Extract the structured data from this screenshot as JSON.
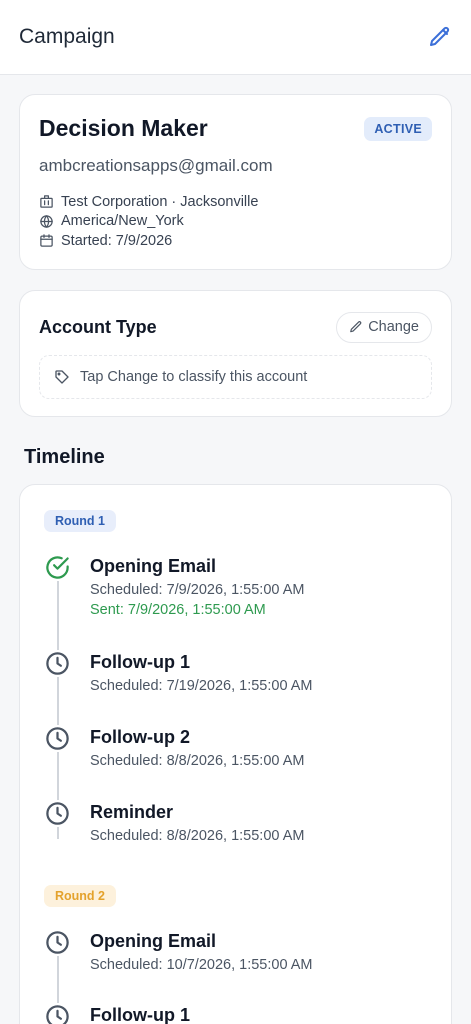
{
  "header": {
    "title": "Campaign",
    "edit_icon": "pencil-icon"
  },
  "profile": {
    "name": "Decision Maker",
    "status": "ACTIVE",
    "email": "ambcreationsapps@gmail.com",
    "company": "Test Corporation · Jacksonville",
    "timezone": "America/New_York",
    "started": "Started: 7/9/2026"
  },
  "account_type": {
    "title": "Account Type",
    "change_label": "Change",
    "placeholder": "Tap Change to classify this account"
  },
  "timeline": {
    "title": "Timeline",
    "rounds": [
      {
        "label": "Round 1",
        "items": [
          {
            "title": "Opening Email",
            "scheduled": "Scheduled: 7/9/2026, 1:55:00 AM",
            "sent": "Sent: 7/9/2026, 1:55:00 AM",
            "status": "sent"
          },
          {
            "title": "Follow-up 1",
            "scheduled": "Scheduled: 7/19/2026, 1:55:00 AM",
            "status": "pending"
          },
          {
            "title": "Follow-up 2",
            "scheduled": "Scheduled: 8/8/2026, 1:55:00 AM",
            "status": "pending"
          },
          {
            "title": "Reminder",
            "scheduled": "Scheduled: 8/8/2026, 1:55:00 AM",
            "status": "pending"
          }
        ]
      },
      {
        "label": "Round 2",
        "items": [
          {
            "title": "Opening Email",
            "scheduled": "Scheduled: 10/7/2026, 1:55:00 AM",
            "status": "pending"
          },
          {
            "title": "Follow-up 1",
            "scheduled": "",
            "status": "pending"
          }
        ]
      }
    ]
  },
  "colors": {
    "active_bg": "#e3ecfb",
    "active_fg": "#2f5fb3",
    "sent": "#2e9a4f",
    "round2_bg": "#fdf1dc",
    "round2_fg": "#e4a22c",
    "edit": "#3b6fd8"
  }
}
